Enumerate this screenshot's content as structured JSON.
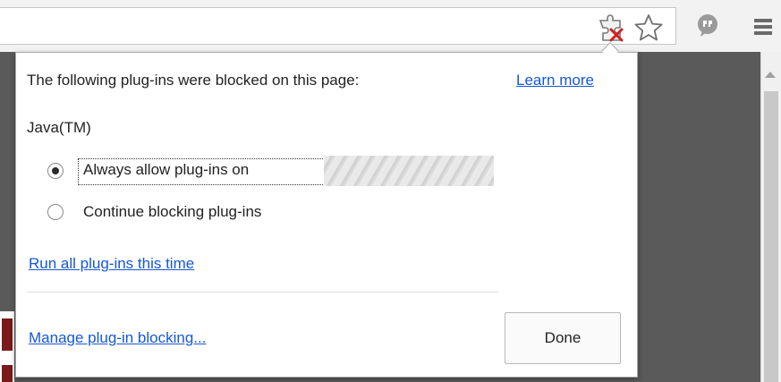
{
  "toolbar": {
    "icons": {
      "plugin_blocked": "plugin-blocked-icon",
      "bookmark": "star-icon",
      "extension": "extension-icon",
      "menu": "menu-icon"
    }
  },
  "bubble": {
    "heading": "The following plug-ins were blocked on this page:",
    "learn_more": "Learn more",
    "plugin_name": "Java(TM)",
    "options": [
      {
        "label": "Always allow plug-ins on",
        "selected": true
      },
      {
        "label": "Continue blocking plug-ins",
        "selected": false
      }
    ],
    "run_all": "Run all plug-ins this time",
    "manage": "Manage plug-in blocking...",
    "done": "Done"
  },
  "colors": {
    "link": "#1558d6",
    "page_background": "#5a5a5a"
  }
}
